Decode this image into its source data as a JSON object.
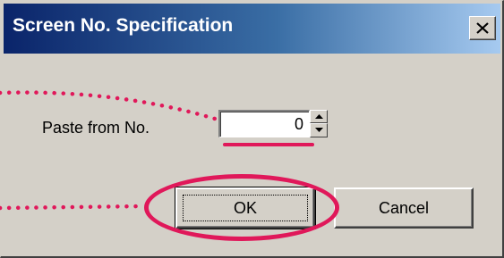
{
  "dialog": {
    "title": "Screen No. Specification",
    "close_glyph": "✕",
    "paste_label": "Paste from No.",
    "paste_value": "0",
    "ok_label": "OK",
    "cancel_label": "Cancel"
  },
  "annotation": {
    "color": "#e0185a",
    "titlebar_gradient": [
      "#0a246a",
      "#a6caf0"
    ]
  },
  "icons": {
    "close": "close-icon",
    "spin_up": "spin-up-icon",
    "spin_down": "spin-down-icon"
  }
}
